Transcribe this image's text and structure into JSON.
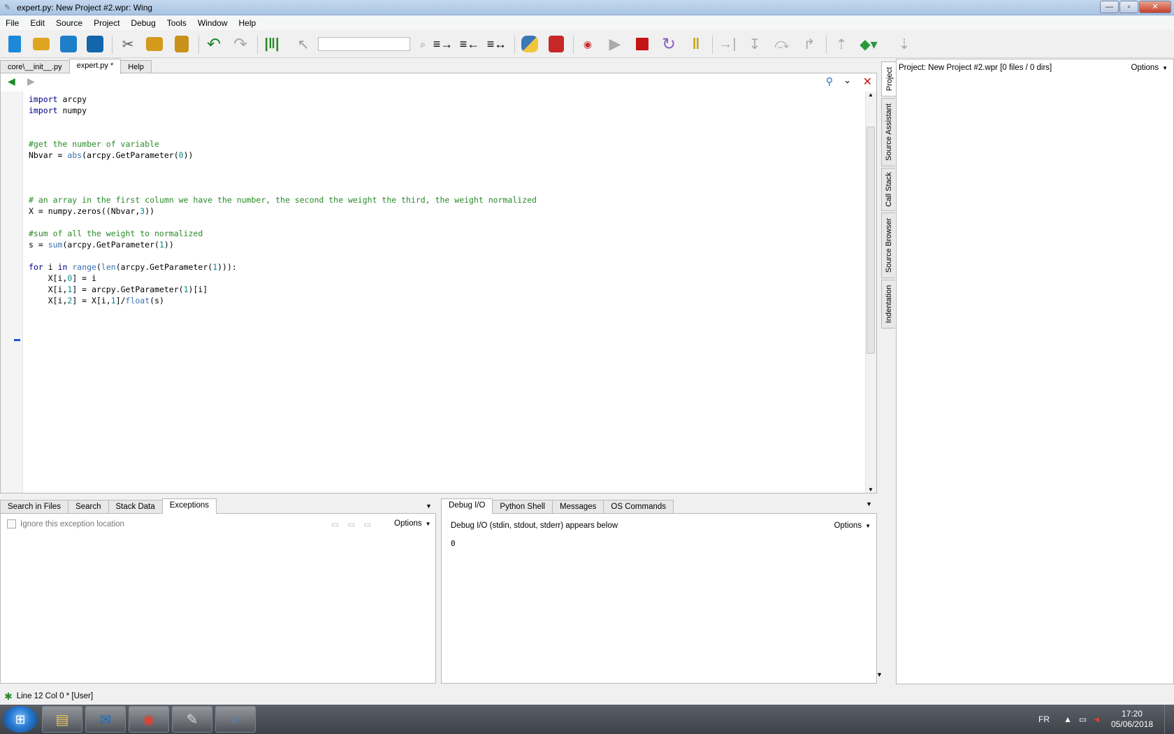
{
  "window": {
    "title": "expert.py: New Project #2.wpr: Wing",
    "controls": {
      "minimize": "—",
      "maximize": "▫",
      "close": "✕"
    }
  },
  "menu": [
    "File",
    "Edit",
    "Source",
    "Project",
    "Debug",
    "Tools",
    "Window",
    "Help"
  ],
  "toolbar": {
    "search_value": "",
    "icons": [
      "new-file-icon",
      "open-folder-icon",
      "save-icon",
      "save-all-icon",
      "cut-icon",
      "copy-icon",
      "paste-icon",
      "undo-icon",
      "redo-icon",
      "indent-guides-icon",
      "pointer-icon",
      "search-icon",
      "indent-icon",
      "outdent-icon",
      "toggle-indent-icon",
      "python-icon",
      "wrench-icon",
      "breakpoint-icon",
      "run-icon",
      "stop-icon",
      "restart-icon",
      "pause-icon",
      "step-to-icon",
      "step-into-icon",
      "step-over-icon",
      "step-out-icon",
      "frame-up-icon",
      "frame-down-icon"
    ]
  },
  "editor": {
    "tabs": [
      {
        "label": "core\\__init__.py",
        "active": false
      },
      {
        "label": "expert.py *",
        "active": true
      },
      {
        "label": "Help",
        "active": false
      }
    ],
    "lines": [
      [
        {
          "t": "import",
          "c": "kw"
        },
        {
          "t": " arcpy",
          "c": ""
        }
      ],
      [
        {
          "t": "import",
          "c": "kw"
        },
        {
          "t": " numpy",
          "c": ""
        }
      ],
      [],
      [],
      [
        {
          "t": "#get the number of variable",
          "c": "cm"
        }
      ],
      [
        {
          "t": "Nbvar = ",
          "c": ""
        },
        {
          "t": "abs",
          "c": "bi"
        },
        {
          "t": "(arcpy.GetParameter(",
          "c": ""
        },
        {
          "t": "0",
          "c": "nm"
        },
        {
          "t": "))",
          "c": ""
        }
      ],
      [],
      [],
      [],
      [
        {
          "t": "# an array in the first column we have the number, the second the weight the third, the weight normalized",
          "c": "cm"
        }
      ],
      [
        {
          "t": "X = numpy.zeros((Nbvar,",
          "c": ""
        },
        {
          "t": "3",
          "c": "nm"
        },
        {
          "t": "))",
          "c": ""
        }
      ],
      [],
      [
        {
          "t": "#sum of all the weight to normalized",
          "c": "cm"
        }
      ],
      [
        {
          "t": "s = ",
          "c": ""
        },
        {
          "t": "sum",
          "c": "bi"
        },
        {
          "t": "(arcpy.GetParameter(",
          "c": ""
        },
        {
          "t": "1",
          "c": "nm"
        },
        {
          "t": "))",
          "c": ""
        }
      ],
      [],
      [
        {
          "t": "for",
          "c": "kw"
        },
        {
          "t": " i ",
          "c": ""
        },
        {
          "t": "in",
          "c": "kw"
        },
        {
          "t": " ",
          "c": ""
        },
        {
          "t": "range",
          "c": "bi"
        },
        {
          "t": "(",
          "c": ""
        },
        {
          "t": "len",
          "c": "bi"
        },
        {
          "t": "(arcpy.GetParameter(",
          "c": ""
        },
        {
          "t": "1",
          "c": "nm"
        },
        {
          "t": "))):",
          "c": ""
        }
      ],
      [
        {
          "t": "    X[i,",
          "c": ""
        },
        {
          "t": "0",
          "c": "nm"
        },
        {
          "t": "] = i",
          "c": ""
        }
      ],
      [
        {
          "t": "    X[i,",
          "c": ""
        },
        {
          "t": "1",
          "c": "nm"
        },
        {
          "t": "] = arcpy.GetParameter(",
          "c": ""
        },
        {
          "t": "1",
          "c": "nm"
        },
        {
          "t": ")[i]",
          "c": ""
        }
      ],
      [
        {
          "t": "    X[i,",
          "c": ""
        },
        {
          "t": "2",
          "c": "nm"
        },
        {
          "t": "] = X[i,",
          "c": ""
        },
        {
          "t": "1",
          "c": "nm"
        },
        {
          "t": "]/",
          "c": ""
        },
        {
          "t": "float",
          "c": "bi"
        },
        {
          "t": "(s)",
          "c": ""
        }
      ]
    ]
  },
  "project_panel": {
    "header": "Project: New Project #2.wpr [0 files / 0 dirs]",
    "options_label": "Options",
    "side_tabs": [
      "Project",
      "Source Assistant",
      "Call Stack",
      "Source Browser",
      "Indentation"
    ]
  },
  "left_bottom": {
    "tabs": [
      "Search in Files",
      "Search",
      "Stack Data",
      "Exceptions"
    ],
    "active_tab": "Exceptions",
    "checkbox_label": "Ignore this exception location",
    "options_label": "Options"
  },
  "right_bottom": {
    "tabs": [
      "Debug I/O",
      "Python Shell",
      "Messages",
      "OS Commands"
    ],
    "active_tab": "Debug I/O",
    "info": "Debug I/O (stdin, stdout, stderr) appears below",
    "options_label": "Options",
    "output": "0"
  },
  "status": {
    "text": "Line 12 Col 0 * [User]"
  },
  "taskbar": {
    "apps": [
      "explorer-icon",
      "outlook-icon",
      "chrome-icon",
      "wing-ide-icon",
      "search-app-icon"
    ],
    "language": "FR",
    "time": "17:20",
    "date": "05/06/2018"
  }
}
